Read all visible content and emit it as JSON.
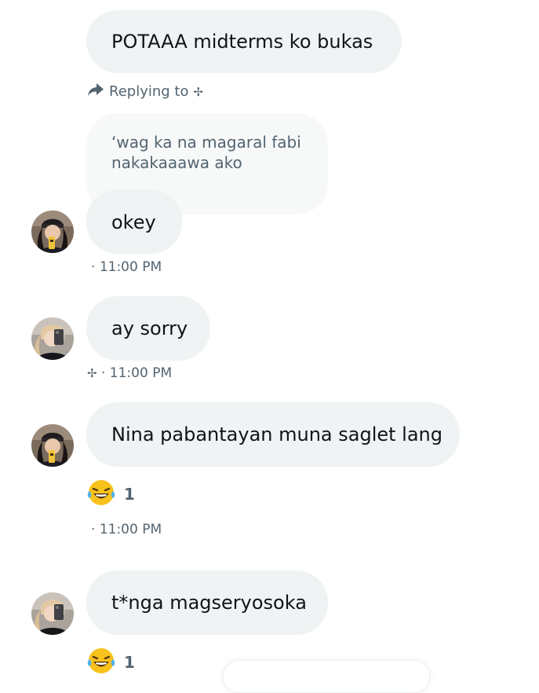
{
  "messages": [
    {
      "text": "POTAAA midterms ko bukas"
    },
    {
      "text": "okey",
      "timestamp": "11:00 PM"
    },
    {
      "text": "ay sorry",
      "timestamp": "11:00 PM"
    },
    {
      "text": "Nina pabantayan muna saglet lang",
      "timestamp": "11:00 PM",
      "reaction_count": "1"
    },
    {
      "text": "t*nga magseryosoka",
      "reaction_count": "1"
    }
  ],
  "reply": {
    "label": "Replying to",
    "symbol": "✢",
    "quoted_line1": "‘wag ka na magaral fabi",
    "quoted_line2": "nakakaaawa ako"
  },
  "meta": {
    "dot": "·",
    "name_symbol": "✢"
  },
  "icons": {
    "reply": "reply-arrow-icon",
    "reaction": "laughing-emoji-icon"
  },
  "colors": {
    "bubble": "#eff3f4",
    "quoted_bubble": "#f7f9f9",
    "secondary_text": "#536471",
    "primary_text": "#0f1419"
  }
}
